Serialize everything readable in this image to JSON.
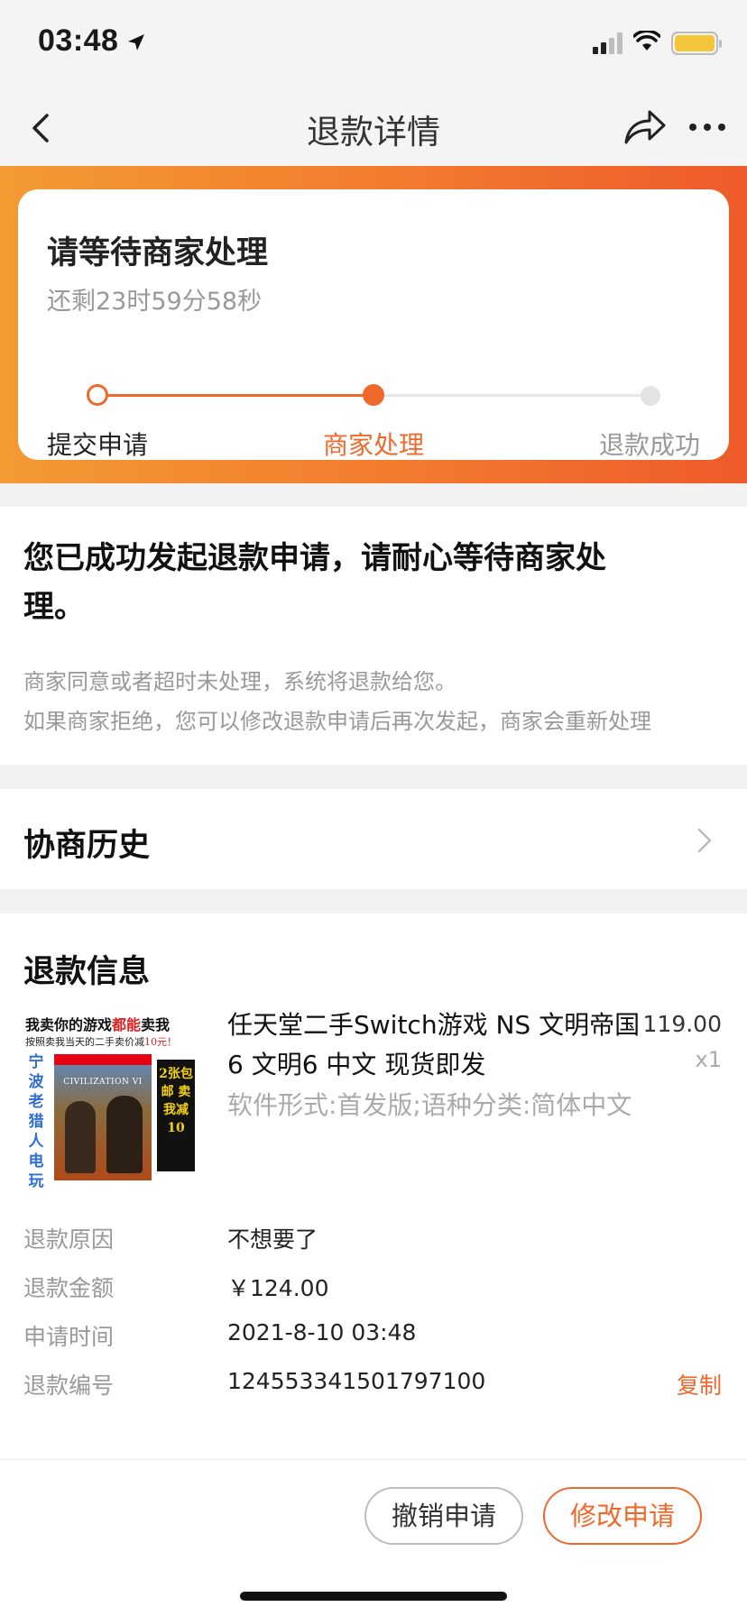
{
  "status_bar": {
    "time": "03:48",
    "icons": [
      "location-arrow-icon",
      "signal-icon",
      "wifi-icon",
      "battery-icon"
    ],
    "battery_color": "#f4c53a"
  },
  "nav": {
    "title": "退款详情",
    "icons": [
      "back-icon",
      "share-icon",
      "more-icon"
    ]
  },
  "progress": {
    "title": "请等待商家处理",
    "countdown": "还剩23时59分58秒",
    "steps": [
      {
        "label": "提交申请",
        "state": "done"
      },
      {
        "label": "商家处理",
        "state": "current"
      },
      {
        "label": "退款成功",
        "state": "pending"
      }
    ],
    "accent_color": "#f0692c"
  },
  "message": {
    "headline": "您已成功发起退款申请，请耐心等待商家处理。",
    "line1": "商家同意或者超时未处理，系统将退款给您。",
    "line2": "如果商家拒绝，您可以修改退款申请后再次发起，商家会重新处理"
  },
  "history": {
    "title": "协商历史"
  },
  "refund_info": {
    "title": "退款信息",
    "product": {
      "image_text_top1": "我卖你的游戏都能卖我",
      "image_text_top1_prefix": "我卖你的游戏",
      "image_text_top1_red": "都能",
      "image_text_top1_suffix": "卖我",
      "image_text_top2_prefix": "按照卖我当天的二手卖价减",
      "image_text_top2_red": "10元！",
      "image_side_text": "宁波老猎人电玩",
      "image_cover_title": "CIVILIZATION VI",
      "image_badge": "2张包邮 卖我减10",
      "title": "任天堂二手Switch游戏 NS 文明帝国6 文明6 中文 现货即发",
      "spec": "软件形式:首发版;语种分类:简体中文",
      "price": "119.00",
      "quantity": "x1"
    },
    "rows": [
      {
        "label": "退款原因",
        "value": "不想要了"
      },
      {
        "label": "退款金额",
        "value": "￥124.00"
      },
      {
        "label": "申请时间",
        "value": "2021-8-10 03:48"
      },
      {
        "label": "退款编号",
        "value": "124553341501797100"
      }
    ],
    "copy_label": "复制"
  },
  "actions": {
    "cancel_label": "撤销申请",
    "modify_label": "修改申请"
  }
}
